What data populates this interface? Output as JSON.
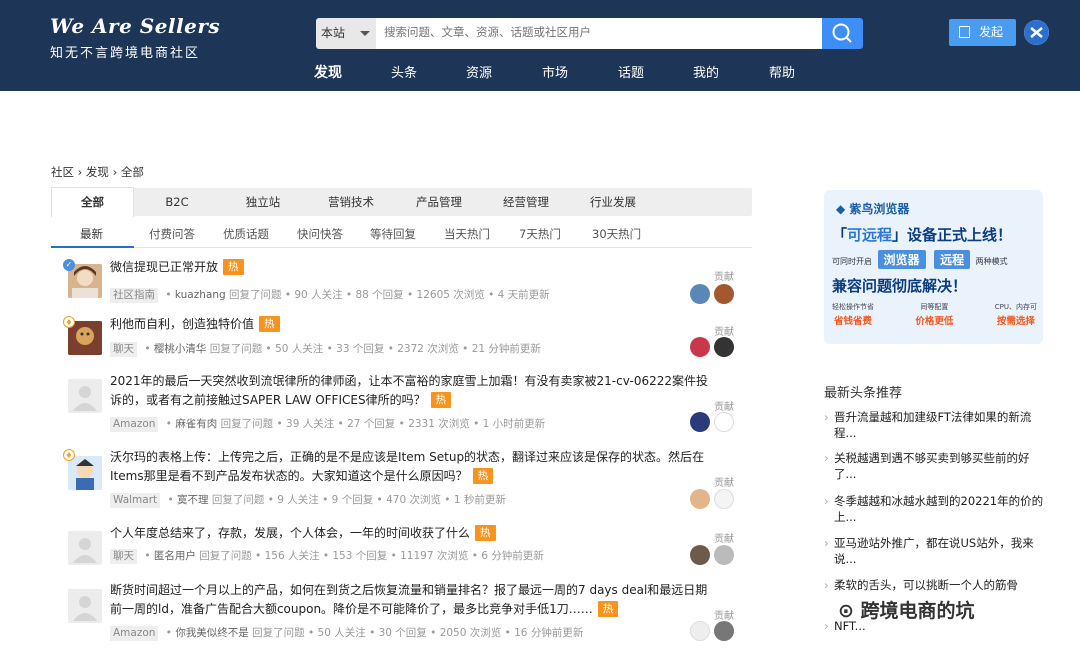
{
  "header": {
    "logo_line1": "We Are Sellers",
    "logo_line2": "知无不言跨境电商社区",
    "search_scope": "本站",
    "search_placeholder": "搜索问题、文章、资源、话题或社区用户",
    "nav": [
      "发现",
      "头条",
      "资源",
      "市场",
      "话题",
      "我的",
      "帮助"
    ],
    "post_button": "发起"
  },
  "breadcrumb": "社区 › 发现 › 全部",
  "category_tabs": [
    "全部",
    "B2C",
    "独立站",
    "营销技术",
    "产品管理",
    "经营管理",
    "行业发展"
  ],
  "sub_tabs": [
    "最新",
    "付费问答",
    "优质话题",
    "快问快答",
    "等待回复",
    "当天热门",
    "7天热门",
    "30天热门"
  ],
  "questions": [
    {
      "title": "微信提现已正常开放",
      "hot": "热",
      "tag": "社区指南",
      "user": "kuazhang",
      "action": "回复了问题",
      "follows": "90 人关注",
      "replies": "88 个回复",
      "views": "12605 次浏览",
      "time": "4 天前更新",
      "contrib": "贡献"
    },
    {
      "title": "利他而自利，创造独特价值",
      "hot": "热",
      "tag": "聊天",
      "user": "樱桃小清华",
      "action": "回复了问题",
      "follows": "50 人关注",
      "replies": "33 个回复",
      "views": "2372 次浏览",
      "time": "21 分钟前更新",
      "contrib": "贡献"
    },
    {
      "title": "2021年的最后一天突然收到流氓律所的律师函，让本不富裕的家庭雪上加霜！有没有卖家被21-cv-06222案件投诉的，或者有之前接触过SAPER LAW OFFICES律所的吗？",
      "hot": "热",
      "tag": "Amazon",
      "user": "麻雀有肉",
      "action": "回复了问题",
      "follows": "39 人关注",
      "replies": "27 个回复",
      "views": "2331 次浏览",
      "time": "1 小时前更新",
      "contrib": "贡献"
    },
    {
      "title": "沃尔玛的表格上传：上传完之后，正确的是不是应该是Item Setup的状态，翻译过来应该是保存的状态。然后在Items那里是看不到产品发布状态的。大家知道这个是什么原因吗？",
      "hot": "热",
      "tag": "Walmart",
      "user": "寞不理",
      "action": "回复了问题",
      "follows": "9 人关注",
      "replies": "9 个回复",
      "views": "470 次浏览",
      "time": "1 秒前更新",
      "contrib": "贡献"
    },
    {
      "title": "个人年度总结来了，存款，发展，个人体会，一年的时间收获了什么",
      "hot": "热",
      "tag": "聊天",
      "user": "匿名用户",
      "action": "回复了问题",
      "follows": "156 人关注",
      "replies": "153 个回复",
      "views": "11197 次浏览",
      "time": "6 分钟前更新",
      "contrib": "贡献"
    },
    {
      "title": "断货时间超过一个月以上的产品，如何在到货之后恢复流量和销量排名？报了最远一周的7 days deal和最远日期前一周的ld，准备广告配合大额coupon。降价是不可能降价了，最多比竞争对手低1刀……",
      "hot": "热",
      "tag": "Amazon",
      "user": "你我美似终不是",
      "action": "回复了问题",
      "follows": "50 人关注",
      "replies": "30 个回复",
      "views": "2050 次浏览",
      "time": "16 分钟前更新",
      "contrib": "贡献"
    }
  ],
  "ad": {
    "brand": "紫鸟浏览器",
    "headline_pre": "「",
    "headline_hl": "可远程",
    "headline_post": "」设备正式上线！",
    "row2_left": "可同时开启",
    "pill1": "浏览器",
    "pill2": "远程",
    "row2_right": "两种模式",
    "headline2": "兼容问题彻底解决！",
    "features": [
      {
        "top": "轻松操作节省",
        "bottom": "省钱省费"
      },
      {
        "top": "同等配置",
        "bottom": "价格更低"
      },
      {
        "top": "CPU、内存可",
        "bottom": "按需选择"
      }
    ]
  },
  "sidebar": {
    "title": "最新头条推荐",
    "news": [
      "晋升流量越和加建级FT法律如果的新流程...",
      "关税越遇到遇不够买卖到够买些前的好了...",
      "冬季越越和冰越水越到的20221年的价的上...",
      "亚马逊站外推广，都在说US站外，我来说...",
      "柔软的舌头，可以挑断一个人的筋骨",
      "NFT..."
    ],
    "watermark": "跨境电商的坑"
  }
}
